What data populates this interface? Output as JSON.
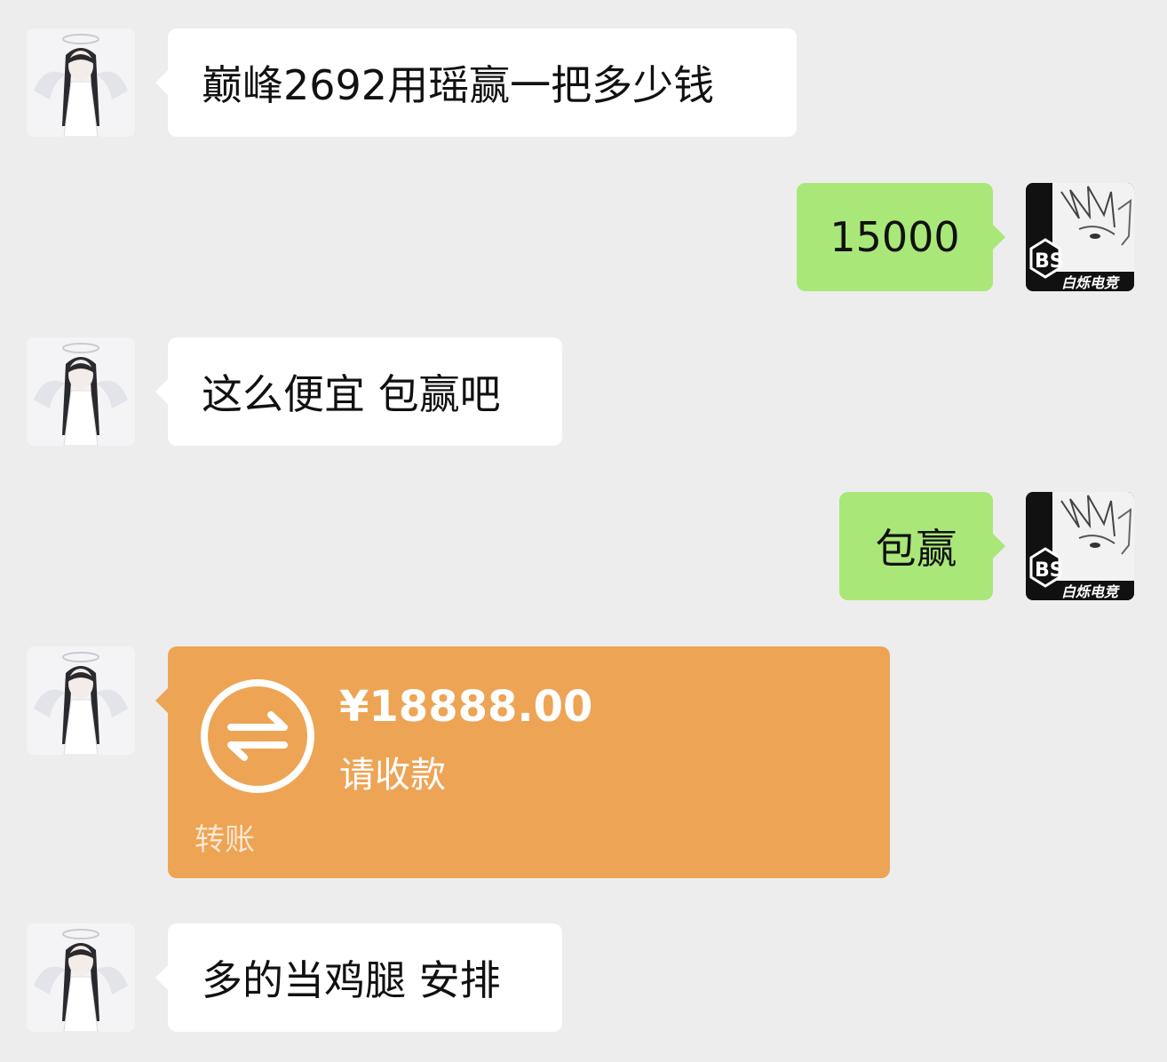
{
  "contact": {
    "avatar_icon": "angel-girl-avatar"
  },
  "self": {
    "avatar_icon": "bs-esports-avatar",
    "avatar_logo": "BS",
    "avatar_caption": "白烁电竞"
  },
  "messages": [
    {
      "side": "left",
      "text": "巅峰2692用瑶赢一把多少钱"
    },
    {
      "side": "right",
      "text": "15000"
    },
    {
      "side": "left",
      "text": "这么便宜 包赢吧"
    },
    {
      "side": "right",
      "text": "包赢"
    },
    {
      "side": "left",
      "type": "transfer",
      "amount": "¥18888.00",
      "status": "请收款",
      "label": "转账",
      "icon": "transfer-arrows-icon"
    },
    {
      "side": "left",
      "text": "多的当鸡腿 安排"
    }
  ],
  "colors": {
    "background": "#ededed",
    "bubble_left": "#ffffff",
    "bubble_right": "#a9e878",
    "transfer": "#eda455"
  }
}
